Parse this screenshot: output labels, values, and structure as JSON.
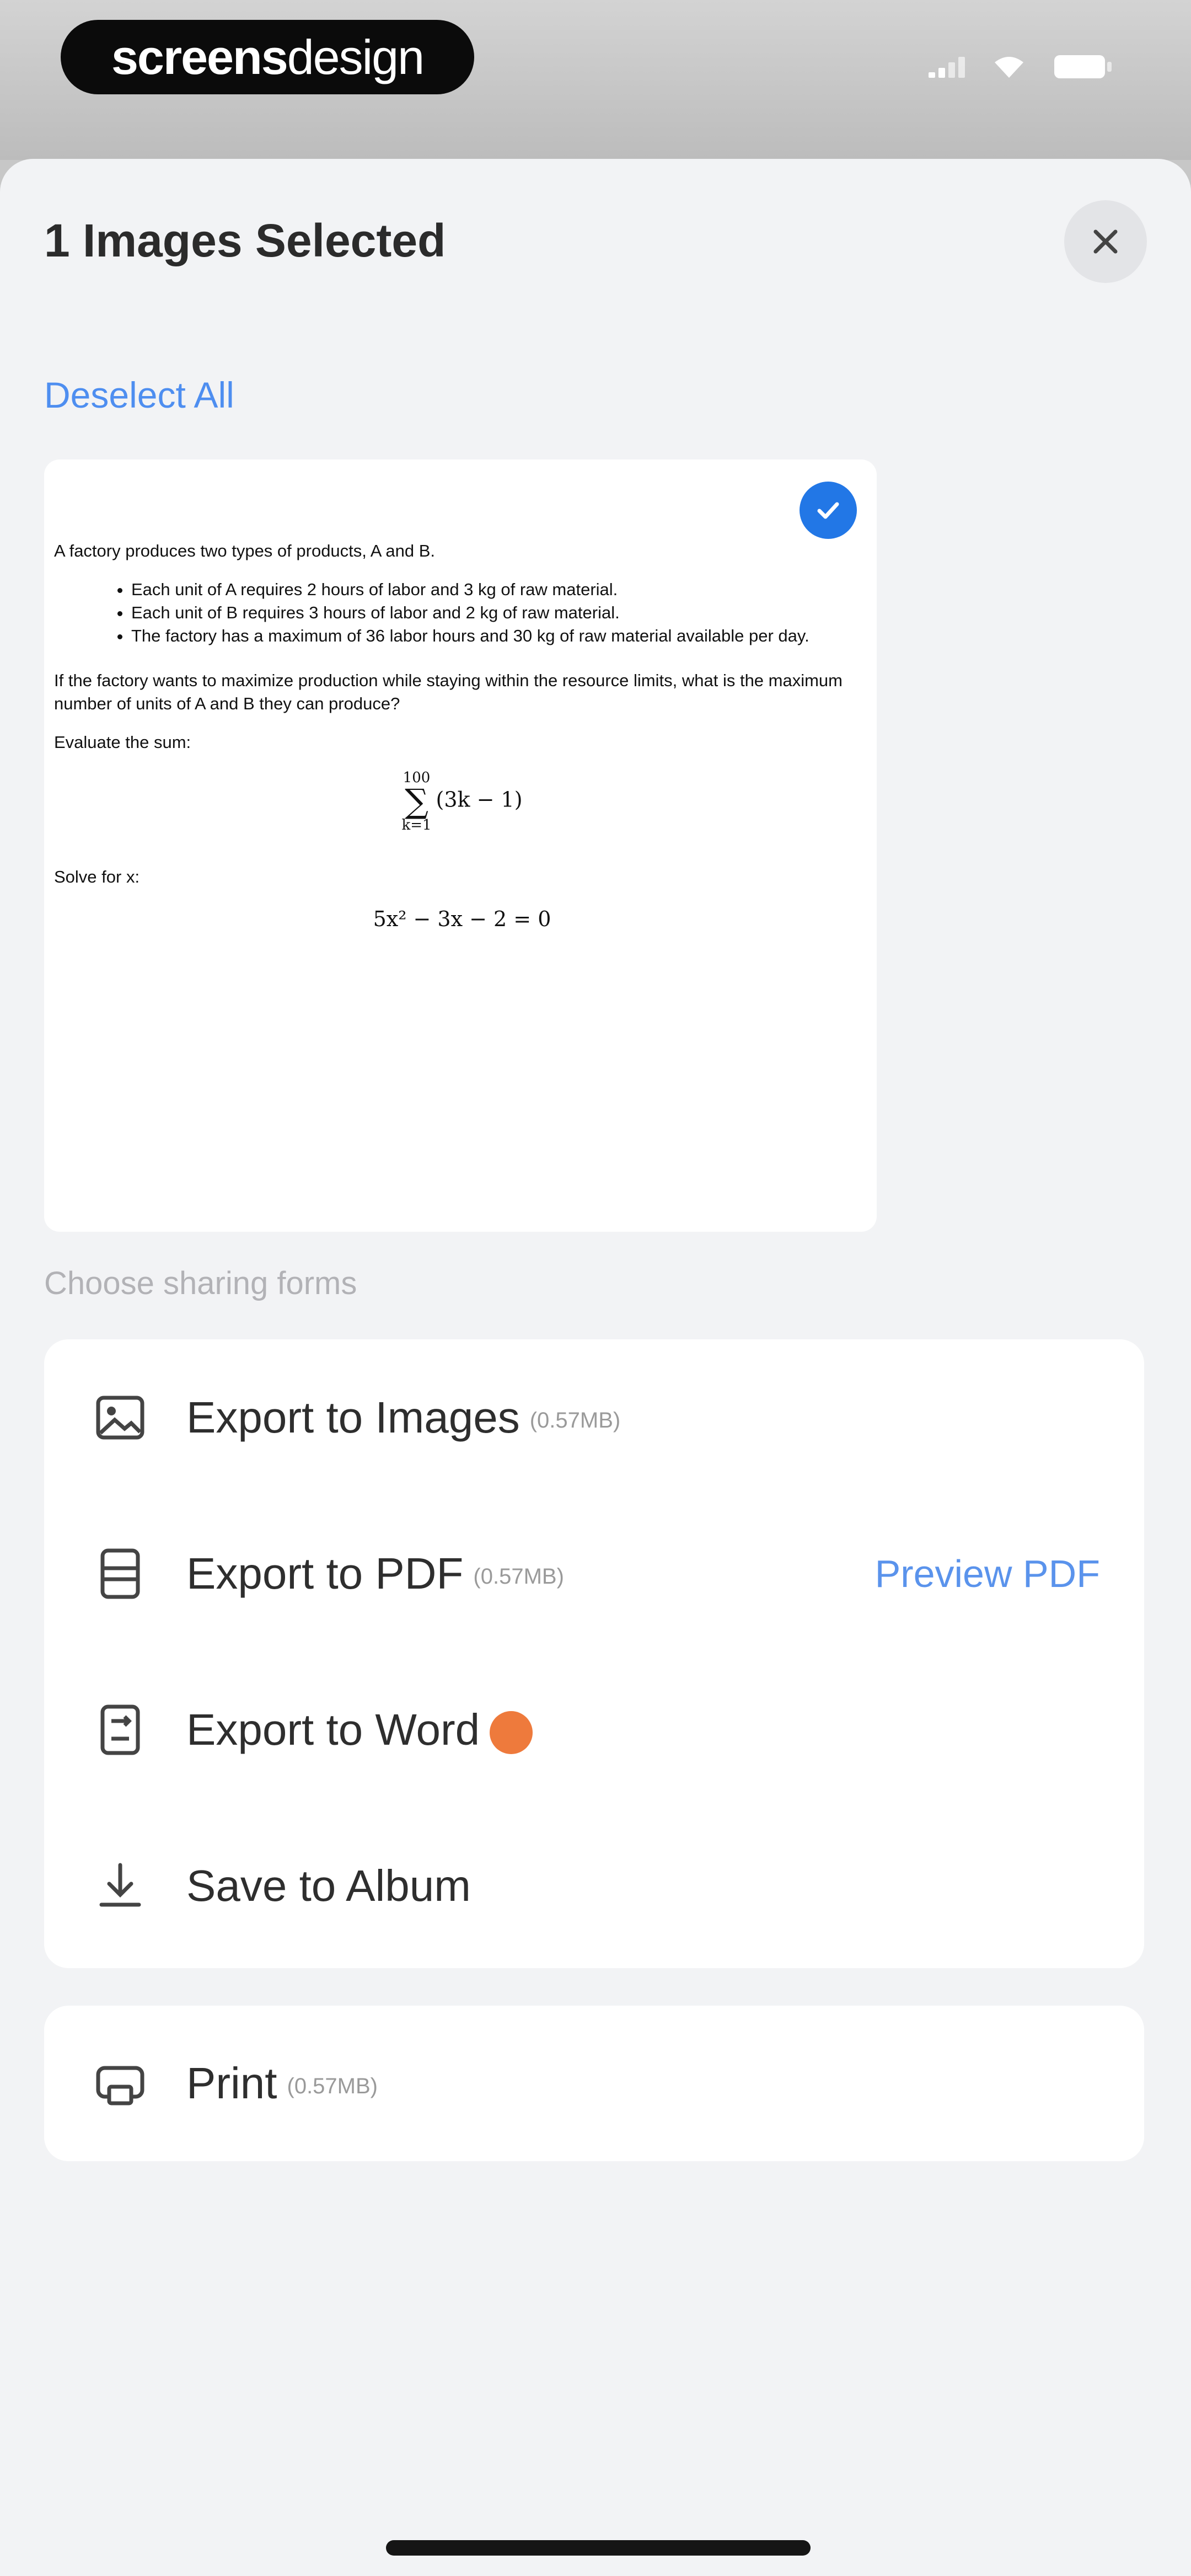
{
  "status_bar": {
    "brand_bold": "screens",
    "brand_light": "design"
  },
  "sheet": {
    "title": "1 Images Selected",
    "deselect_label": "Deselect All",
    "close_icon": "close-icon"
  },
  "document": {
    "intro": "A factory produces two types of products, A and B.",
    "bullets": [
      "Each unit of A requires 2 hours of labor and 3 kg of raw material.",
      "Each unit of B requires 3 hours of labor and 2 kg of raw material.",
      "The factory has a maximum of 36 labor hours and 30 kg of raw material available per day."
    ],
    "question": "If the factory wants to maximize production while staying within the resource limits, what is the maximum number of units of A and B they can produce?",
    "evaluate_label": "Evaluate the sum:",
    "sum_upper": "100",
    "sum_lower": "k=1",
    "sum_expr": "(3k − 1)",
    "solve_label": "Solve for x:",
    "equation": "5x² − 3x − 2 = 0"
  },
  "sharing": {
    "label": "Choose sharing forms",
    "options": [
      {
        "label": "Export to Images",
        "size": "(0.57MB)",
        "icon": "image-icon"
      },
      {
        "label": "Export to PDF",
        "size": "(0.57MB)",
        "icon": "pdf-icon",
        "action": "Preview PDF"
      },
      {
        "label": "Export to Word",
        "icon": "word-icon",
        "badge_color": "#ee7a3c"
      },
      {
        "label": "Save to Album",
        "icon": "download-icon"
      }
    ],
    "print": {
      "label": "Print",
      "size": "(0.57MB)",
      "icon": "print-icon"
    }
  },
  "colors": {
    "accent": "#2277e6",
    "link": "#4e8ef0",
    "badge": "#ee7a3c"
  }
}
